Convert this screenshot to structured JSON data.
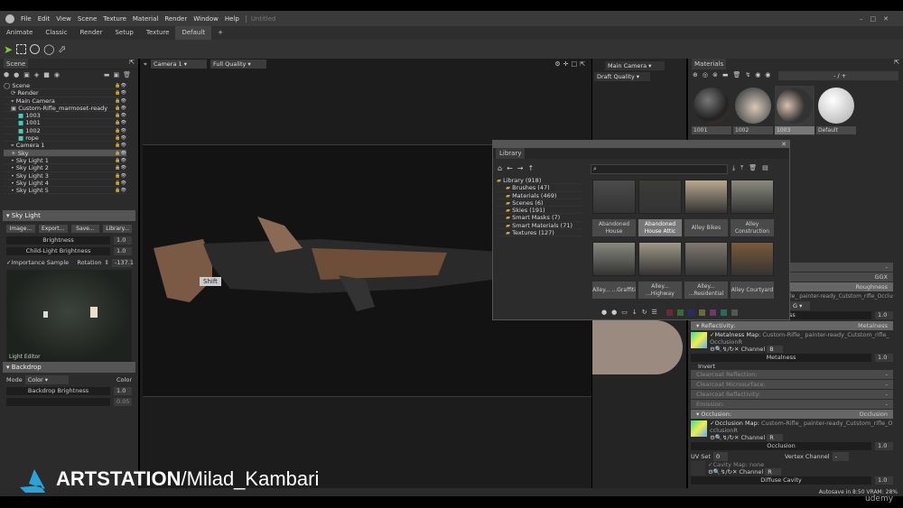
{
  "window": {
    "title": "Untitled",
    "menu": [
      "File",
      "Edit",
      "View",
      "Scene",
      "Texture",
      "Material",
      "Render",
      "Window",
      "Help"
    ]
  },
  "workspace_tabs": [
    "Animate",
    "Classic",
    "Render",
    "Setup",
    "Texture",
    "Default",
    "+"
  ],
  "active_tab": "Default",
  "tools": [
    "select-arrow",
    "rect-select",
    "circle-select",
    "lasso-select",
    "poly-select"
  ],
  "scene": {
    "title": "Scene",
    "tree": [
      "Scene",
      "Render",
      "Main Camera",
      "Custom-Rifle_marmoset-ready",
      "1003",
      "1001",
      "1002",
      "rope",
      "Camera 1",
      "Sky",
      "Sky Light 1",
      "Sky Light 2",
      "Sky Light 3",
      "Sky Light 4",
      "Sky Light 5"
    ],
    "selected": "Sky"
  },
  "sky_light": {
    "title": "Sky Light",
    "buttons": [
      "Image...",
      "Export...",
      "Save...",
      "Library..."
    ],
    "brightness_label": "Brightness",
    "brightness": "1.0",
    "child_label": "Child-Light Brightness",
    "child": "1.0",
    "importance": "Importance Sample",
    "rotation_label": "Rotation",
    "rotation": "-137.1",
    "light_editor": "Light Editor"
  },
  "backdrop": {
    "title": "Backdrop",
    "mode_label": "Mode",
    "mode": "Color",
    "color_label": "Color",
    "brightness_label": "Backdrop Brightness",
    "brightness": "1.0",
    "blur": "0.05"
  },
  "viewport": {
    "camera": "Camera 1",
    "quality": "Full Quality",
    "tooltip": "Shift"
  },
  "viewport2": {
    "camera": "Main Camera",
    "quality": "Draft Quality"
  },
  "materials": {
    "title": "Materials",
    "counter": "- / +",
    "items": [
      "1001",
      "1002",
      "1003",
      "Default"
    ],
    "selected": "1003"
  },
  "library": {
    "title": "Library",
    "tree": [
      "Library (918)",
      "Brushes (47)",
      "Materials (469)",
      "Scenes (6)",
      "Skies (191)",
      "Smart Masks (7)",
      "Smart Materials (71)",
      "Textures (127)"
    ],
    "selected": "Abandoned House Attic",
    "items": [
      {
        "label": "Abandoned House",
        "color": "#4a4c4a"
      },
      {
        "label": "Abandoned House Attic",
        "color": "#3a3c38"
      },
      {
        "label": "Alley Bikes",
        "color": "#b8a890"
      },
      {
        "label": "Alley Construction",
        "color": "#8a8a80"
      },
      {
        "label": "Alley... ...Graffiti",
        "color": "#888880"
      },
      {
        "label": "Alley... ...Highway",
        "color": "#a09888"
      },
      {
        "label": "Alley... ...Residential",
        "color": "#807870"
      },
      {
        "label": "Alley Courtyard",
        "color": "#7a5a3a"
      }
    ],
    "swatches": [
      "#6a2a3a",
      "#3a6a3a",
      "#2a2a6a",
      "#6a6a3a",
      "#6a3a6a",
      "#2a6a5a",
      "#555555"
    ]
  },
  "properties": {
    "top_rows": [
      {
        "label": "",
        "value": "-"
      },
      {
        "label": "",
        "value": "GGX"
      },
      {
        "label": "",
        "value": "Roughness"
      }
    ],
    "roughness_map": "le_ painter-ready_Cutstom_rifle_Occlusion",
    "roughness_channel": "G",
    "roughness_field": "ess",
    "roughness_value": "1.0",
    "reflectivity": {
      "title": "Reflectivity:",
      "value": "Metalness"
    },
    "metalness_map_label": "Metalness Map:",
    "metalness_map": "Custom-Rifle_ painter-ready_Cutstom_rifle_OcclusionR",
    "channel_label": "Channel",
    "metal_channel": "B",
    "metalness_label": "Metalness",
    "metalness": "1.0",
    "invert": "Invert",
    "collapsed": [
      {
        "label": "Clearcoat Reflection:",
        "value": "-"
      },
      {
        "label": "Clearcoat Microsurface:",
        "value": "-"
      },
      {
        "label": "Clearcoat Reflectivity:",
        "value": "-"
      },
      {
        "label": "Emission:",
        "value": "-"
      }
    ],
    "occlusion": {
      "title": "Occlusion:",
      "value": "Occlusion"
    },
    "occlusion_map_label": "Occlusion Map:",
    "occlusion_map": "Custom-Rifle_ painter-ready_Cutstom_rifle_OcclusionR",
    "occ_channel": "R",
    "occlusion_label": "Occlusion",
    "occlusion_value": "1.0",
    "uv_label": "UV Set",
    "uv": "0",
    "vertex_label": "Vertex Channel",
    "vertex": "-",
    "cavity": "Cavity Map: none",
    "cavity_channel": "R",
    "diffuse_cavity": "Diffuse Cavity",
    "diffuse_value": "1.0"
  },
  "status": {
    "text": "Autosave in 8:50   VRAM: 28%"
  },
  "watermark": {
    "brand": "ARTSTATION",
    "user": "/Milad_Kambari",
    "udemy": "udemy"
  }
}
